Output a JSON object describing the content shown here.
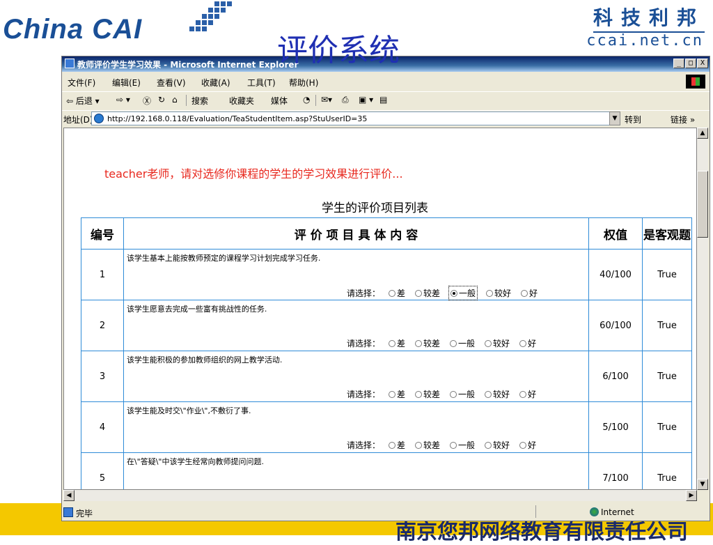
{
  "slide": {
    "title": "评价系统",
    "logo_left": "China CAI",
    "logo_right_cn": "科技利邦",
    "logo_right_en": "ccai.net.cn",
    "footer_text": "南京您邦网络教育有限责任公司"
  },
  "window": {
    "title": "教师评价学生学习效果 - Microsoft Internet Explorer",
    "buttons": [
      "_",
      "□",
      "X"
    ]
  },
  "menubar": [
    "文件(F)",
    "编辑(E)",
    "查看(V)",
    "收藏(A)",
    "工具(T)",
    "帮助(H)"
  ],
  "toolbar": {
    "back": "⇦ 后退 ▾",
    "forward": "⇨ ▾",
    "stop": "Ⓧ",
    "refresh": "↻",
    "home": "⌂",
    "search": "搜索",
    "favorites": "收藏夹",
    "media": "媒体",
    "history": "◔",
    "mail": "✉▾",
    "print": "⎙",
    "edit": "▣ ▾",
    "discuss": "▤"
  },
  "addressbar": {
    "label": "地址(D)",
    "url": "http://192.168.0.118/Evaluation/TeaStudentItem.asp?StuUserID=35",
    "go": "转到",
    "links": "链接 »"
  },
  "page": {
    "intro": "teacher老师，请对选修你课程的学生的学习效果进行评价...",
    "list_title": "学生的评价项目列表",
    "headers": {
      "num": "编号",
      "content": "评 价 项 目 具 体 内 容",
      "weight": "权值",
      "objective": "是客观题"
    },
    "choose_label": "请选择：",
    "options": [
      "差",
      "较差",
      "一般",
      "较好",
      "好"
    ],
    "items": [
      {
        "num": "1",
        "text": "该学生基本上能按教师预定的课程学习计划完成学习任务.",
        "weight": "40/100",
        "objective": "True",
        "selected": 2
      },
      {
        "num": "2",
        "text": "该学生愿意去完成一些富有挑战性的任务.",
        "weight": "60/100",
        "objective": "True",
        "selected": -1
      },
      {
        "num": "3",
        "text": "该学生能积极的参加教师组织的网上教学活动.",
        "weight": "6/100",
        "objective": "True",
        "selected": -1
      },
      {
        "num": "4",
        "text": "该学生能及时交\\\"作业\\\",不敷衍了事.",
        "weight": "5/100",
        "objective": "True",
        "selected": -1
      },
      {
        "num": "5",
        "text": "在\\\"答疑\\\"中该学生经常向教师提问问题.",
        "weight": "7/100",
        "objective": "True",
        "selected": -1
      }
    ]
  },
  "statusbar": {
    "text": "完毕",
    "zone": "Internet"
  }
}
